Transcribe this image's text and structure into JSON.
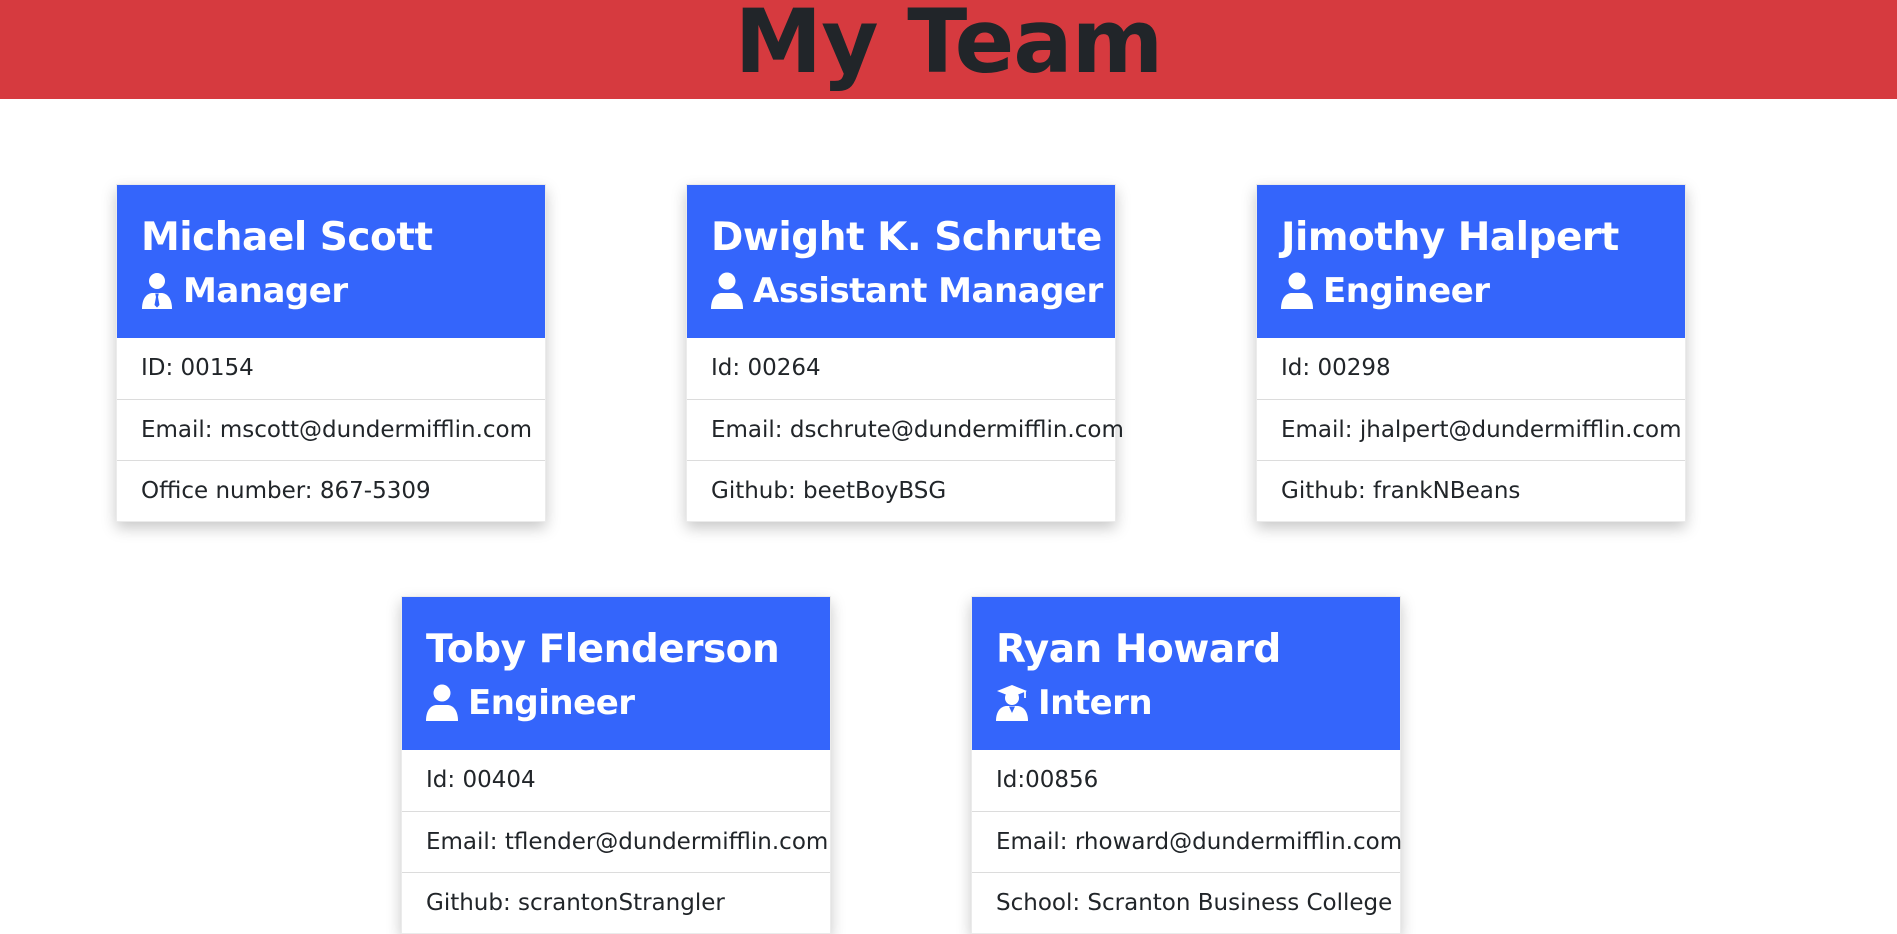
{
  "page": {
    "title": "My Team",
    "header_color": "#d63a3f",
    "card_header_color": "#3465fb"
  },
  "employees": [
    {
      "name": "Michael Scott",
      "role": "Manager",
      "icon": "user-tie-icon",
      "id_line": "ID: 00154",
      "email_line": "Email: mscott@dundermifflin.com",
      "extra_line": "Office number: 867-5309"
    },
    {
      "name": "Dwight K. Schrute",
      "role": "Assistant Manager",
      "icon": "user-icon",
      "id_line": "Id: 00264",
      "email_line": "Email: dschrute@dundermifflin.com",
      "extra_line": "Github: beetBoyBSG"
    },
    {
      "name": "Jimothy Halpert",
      "role": "Engineer",
      "icon": "user-icon",
      "id_line": "Id: 00298",
      "email_line": "Email: jhalpert@dundermifflin.com",
      "extra_line": "Github: frankNBeans"
    },
    {
      "name": "Toby Flenderson",
      "role": "Engineer",
      "icon": "user-icon",
      "id_line": "Id: 00404",
      "email_line": "Email: tflender@dundermifflin.com",
      "extra_line": "Github: scrantonStrangler"
    },
    {
      "name": "Ryan Howard",
      "role": "Intern",
      "icon": "user-graduate-icon",
      "id_line": "Id:00856",
      "email_line": "Email: rhoward@dundermifflin.com",
      "extra_line": "School: Scranton Business College"
    }
  ]
}
